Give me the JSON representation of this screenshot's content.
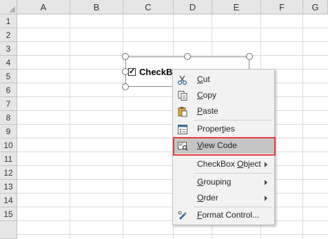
{
  "columns": [
    "A",
    "B",
    "C",
    "D",
    "E",
    "F",
    "G"
  ],
  "rows": [
    "1",
    "2",
    "3",
    "4",
    "5",
    "6",
    "7",
    "8",
    "9",
    "10",
    "11",
    "12",
    "13",
    "14",
    "15"
  ],
  "checkbox": {
    "label": "CheckBox",
    "visible_label": "CheckBo",
    "checked_glyph": "✓"
  },
  "menu": {
    "items": [
      {
        "label": "Cut",
        "icon": "scissors-icon",
        "submenu": false
      },
      {
        "label": "Copy",
        "icon": "copy-icon",
        "submenu": false
      },
      {
        "label": "Paste",
        "icon": "paste-icon",
        "submenu": false
      },
      {
        "label": "Properties",
        "icon": "properties-icon",
        "submenu": false
      },
      {
        "label": "View Code",
        "icon": "view-code-icon",
        "submenu": false,
        "highlighted": true
      },
      {
        "label": "CheckBox Object",
        "icon": "",
        "submenu": true
      },
      {
        "label": "Grouping",
        "icon": "",
        "submenu": true
      },
      {
        "label": "Order",
        "icon": "",
        "submenu": true
      },
      {
        "label": "Format Control...",
        "icon": "format-control-icon",
        "submenu": false
      }
    ]
  },
  "colors": {
    "highlight_border": "#e23b3b",
    "header_bg": "#e6e6e6",
    "menu_bg": "#f2f2f2"
  }
}
